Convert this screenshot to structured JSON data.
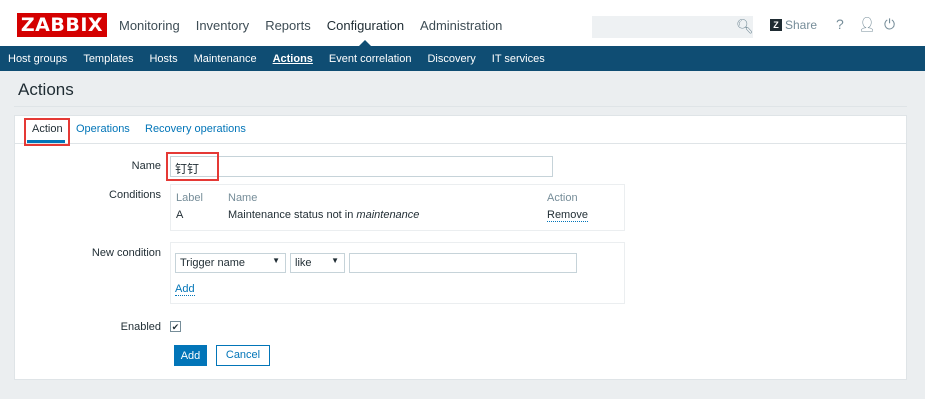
{
  "brand": {
    "logo_text": "ZABBIX",
    "accent": "#d40000",
    "nav_color": "#0f4d73",
    "link_color": "#0275b8"
  },
  "main_menu": [
    {
      "label": "Monitoring"
    },
    {
      "label": "Inventory"
    },
    {
      "label": "Reports"
    },
    {
      "label": "Configuration",
      "active": true
    },
    {
      "label": "Administration"
    }
  ],
  "header": {
    "search_value": "",
    "share_label": "Share",
    "help_icon": "?"
  },
  "sub_menu": [
    {
      "label": "Host groups"
    },
    {
      "label": "Templates"
    },
    {
      "label": "Hosts"
    },
    {
      "label": "Maintenance"
    },
    {
      "label": "Actions",
      "active": true
    },
    {
      "label": "Event correlation"
    },
    {
      "label": "Discovery"
    },
    {
      "label": "IT services"
    }
  ],
  "page": {
    "title": "Actions"
  },
  "tabs": [
    {
      "label": "Action",
      "active": true
    },
    {
      "label": "Operations"
    },
    {
      "label": "Recovery operations"
    }
  ],
  "form": {
    "name_label": "Name",
    "name_value": "钉钉",
    "conditions_label": "Conditions",
    "conditions_headers": {
      "label": "Label",
      "name": "Name",
      "action": "Action"
    },
    "condition_row": {
      "label": "A",
      "name_prefix": "Maintenance status not in ",
      "name_emph": "maintenance",
      "action": "Remove"
    },
    "new_condition_label": "New condition",
    "new_condition": {
      "type_value": "Trigger name",
      "operator_value": "like",
      "value": "",
      "add_link": "Add"
    },
    "enabled_label": "Enabled",
    "enabled_checked": true,
    "add_button": "Add",
    "cancel_button": "Cancel"
  }
}
